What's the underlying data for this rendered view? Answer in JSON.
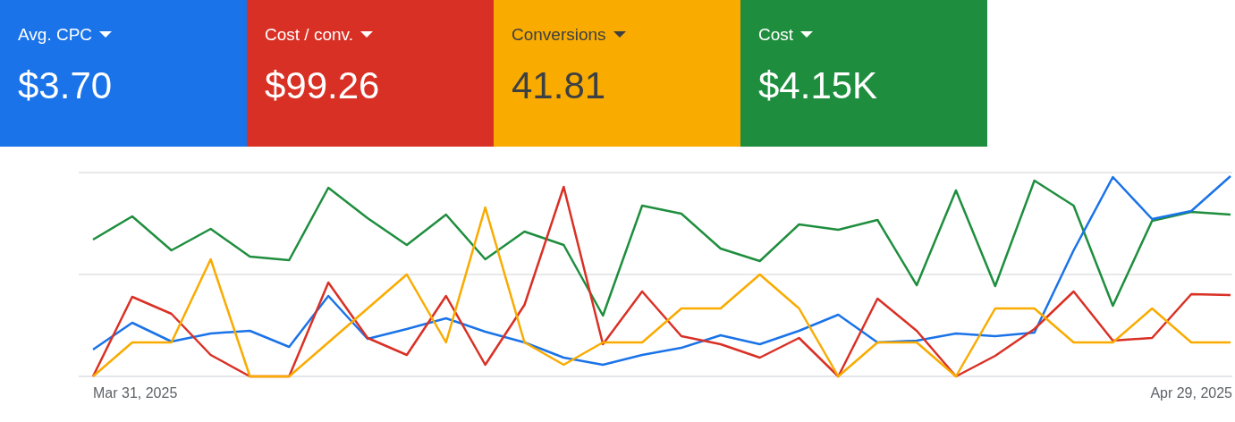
{
  "metrics": [
    {
      "label": "Avg. CPC",
      "value": "$3.70",
      "color": "#1a73e8"
    },
    {
      "label": "Cost / conv.",
      "value": "$99.26",
      "color": "#d93025"
    },
    {
      "label": "Conversions",
      "value": "41.81",
      "color": "#f9ab00"
    },
    {
      "label": "Cost",
      "value": "$4.15K",
      "color": "#1e8e3e"
    }
  ],
  "chart": {
    "x_labels": [
      "Mar 31, 2025",
      "Apr 29, 2025"
    ]
  }
}
